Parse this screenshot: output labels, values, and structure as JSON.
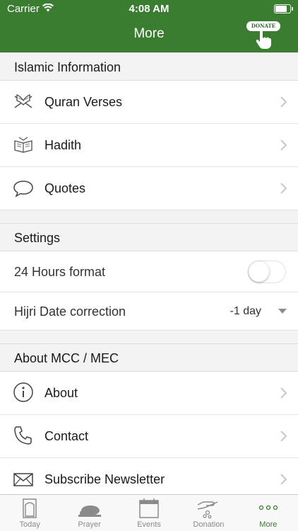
{
  "status_bar": {
    "carrier": "Carrier",
    "time": "4:08 AM",
    "battery_level": 0.9
  },
  "nav": {
    "title": "More",
    "donate_label": "DONATE"
  },
  "sections": {
    "islamic": {
      "title": "Islamic Information",
      "items": [
        {
          "label": "Quran Verses",
          "icon": "quran-icon"
        },
        {
          "label": "Hadith",
          "icon": "hadith-book-icon"
        },
        {
          "label": "Quotes",
          "icon": "speech-bubble-icon"
        }
      ]
    },
    "settings": {
      "title": "Settings",
      "hours_format_label": "24 Hours format",
      "hours_format_on": false,
      "hijri_label": "Hijri Date correction",
      "hijri_value": "-1 day"
    },
    "about": {
      "title": "About MCC / MEC",
      "items": [
        {
          "label": "About",
          "icon": "info-icon"
        },
        {
          "label": "Contact",
          "icon": "phone-icon"
        },
        {
          "label": "Subscribe Newsletter",
          "icon": "envelope-icon"
        }
      ]
    }
  },
  "tabbar": {
    "active": "More",
    "tabs": [
      {
        "label": "Today",
        "icon": "door-icon"
      },
      {
        "label": "Prayer",
        "icon": "prayer-icon"
      },
      {
        "label": "Events",
        "icon": "calendar-icon"
      },
      {
        "label": "Donation",
        "icon": "donation-hand-icon"
      },
      {
        "label": "More",
        "icon": "more-dots-icon"
      }
    ]
  },
  "colors": {
    "brand_green": "#3a7d31",
    "tab_inactive": "#8a8a8a",
    "section_bg": "#f3f3f3"
  }
}
